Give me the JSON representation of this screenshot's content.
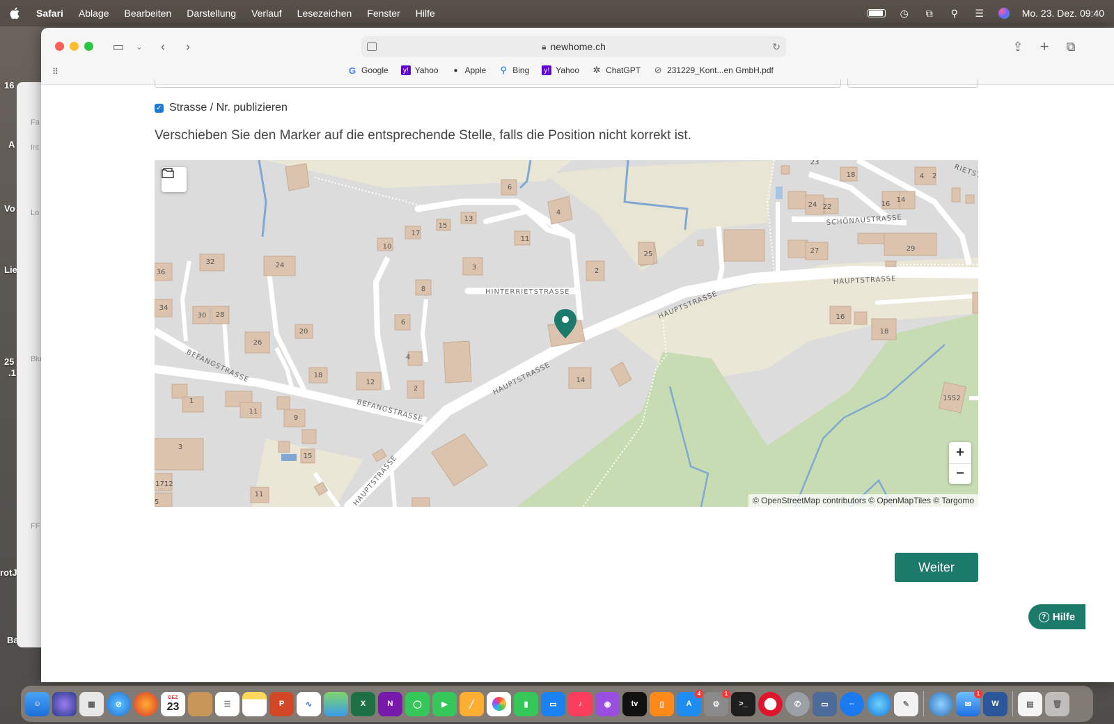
{
  "menubar": {
    "app_name": "Safari",
    "menus": [
      "Ablage",
      "Bearbeiten",
      "Darstellung",
      "Verlauf",
      "Lesezeichen",
      "Fenster",
      "Hilfe"
    ],
    "datetime": "Mo. 23. Dez. 09:40"
  },
  "browser": {
    "url": "newhome.ch",
    "bookmarks": [
      {
        "label": "Google",
        "icon": "google-icon",
        "color": "#4285f4"
      },
      {
        "label": "Yahoo",
        "icon": "yahoo-icon",
        "color": "#6001d2"
      },
      {
        "label": "Apple",
        "icon": "apple-icon",
        "color": "#333333"
      },
      {
        "label": "Bing",
        "icon": "bing-search-icon",
        "color": "#1a73e8"
      },
      {
        "label": "Yahoo",
        "icon": "yahoo-icon",
        "color": "#6001d2"
      },
      {
        "label": "ChatGPT",
        "icon": "chatgpt-icon",
        "color": "#444444"
      },
      {
        "label": "231229_Kont...en GmbH.pdf",
        "icon": "compass-icon",
        "color": "#666666"
      }
    ]
  },
  "form": {
    "checkbox_label": "Strasse / Nr. publizieren",
    "checkbox_checked": true,
    "instruction": "Verschieben Sie den Marker auf die entsprechende Stelle, falls die Position nicht korrekt ist."
  },
  "map": {
    "zoom_in": "+",
    "zoom_out": "−",
    "attribution": "© OpenStreetMap contributors © OpenMapTiles © Targomo",
    "street_labels": [
      "HINTERRIETSTRASSE",
      "HAUPTSTRASSE",
      "HAUPTSTRASSE",
      "HAUPTSTRASSE",
      "HAUPTSTRASSE",
      "BEFANGSTRASSE",
      "BEFANGSTRASSE",
      "SCHÖNAUSTRASSE",
      "RIETST"
    ],
    "marker_color": "#1c7a6a"
  },
  "actions": {
    "next_label": "Weiter",
    "help_label": "Hilfe"
  },
  "desktop_labels": [
    "16",
    "A",
    "Vo",
    "Lie",
    "25",
    ".1",
    "rotJ",
    "Ba"
  ],
  "sidebar_fragments": [
    "Fa",
    "Int",
    "Lo",
    "Blu",
    "FF"
  ],
  "dock": {
    "calendar_month": "DEZ",
    "calendar_day": "23",
    "badges": {
      "appstore": "4",
      "settings": "1",
      "mail": "1"
    }
  }
}
